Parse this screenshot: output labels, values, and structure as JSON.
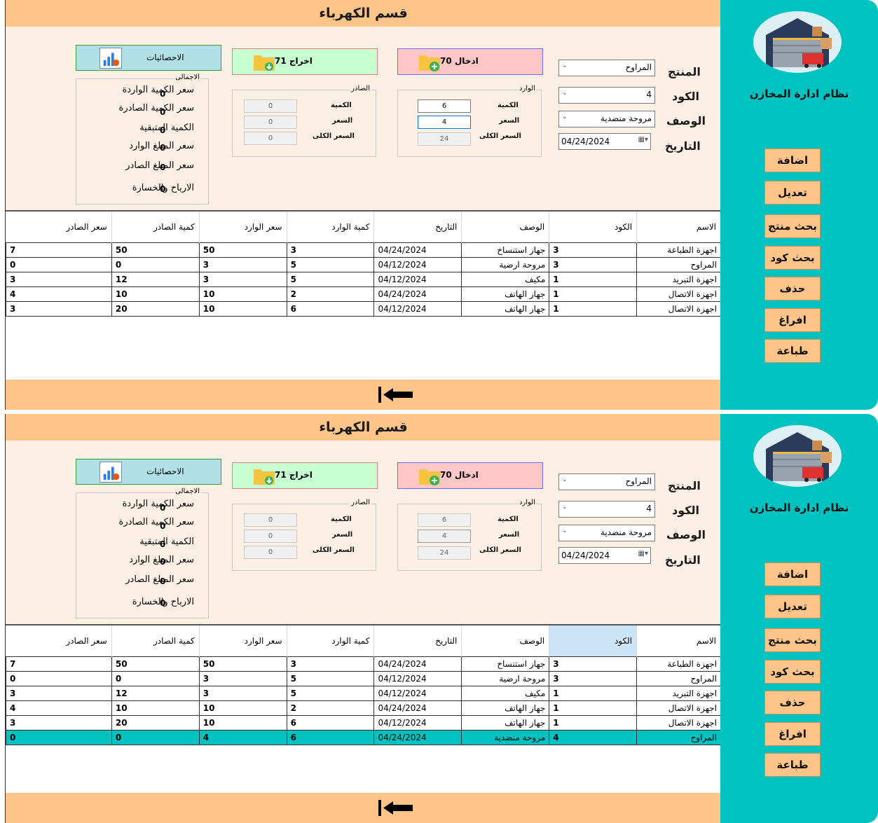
{
  "panels": [
    {
      "title": "قسم الكهرباء",
      "sidebar": {
        "app_name": "نظام ادارة المخازن",
        "buttons": [
          "اضافة",
          "تعديل",
          "بحث منتج",
          "بحث كود",
          "حذف",
          "افراغ",
          "طباعة"
        ]
      },
      "form": {
        "product_label": "المنتج",
        "product_value": "المراوح",
        "code_label": "الكود",
        "code_value": "4",
        "desc_label": "الوصف",
        "desc_value": "مروحة منضدية",
        "date_label": "التاريخ",
        "date_value": "04/24/2024"
      },
      "actions": {
        "in_label": "ادخال 70",
        "out_label": "اخراج 71",
        "stats_label": "الاحصائيات"
      },
      "incoming": {
        "title": "الوارد",
        "qty_label": "الكمية",
        "qty": "6",
        "price_label": "السعر",
        "price": "4",
        "total_label": "السعر الكلى",
        "total": "24"
      },
      "outgoing": {
        "title": "الصادر",
        "qty_label": "الكمية",
        "qty": "0",
        "price_label": "السعر",
        "price": "0",
        "total_label": "السعر الكلى",
        "total": "0"
      },
      "totals": {
        "title": "الاجمالى",
        "rows": [
          {
            "label": "سعر الكمية الواردة",
            "value": "0"
          },
          {
            "label": "سعر الكمية الصادرة",
            "value": "0"
          },
          {
            "label": "الكمية المتبقية",
            "value": "0"
          },
          {
            "label": "سعر المبلغ الوارد",
            "value": "0"
          },
          {
            "label": "سعر المبلغ الصادر",
            "value": "0"
          },
          {
            "label": "الارباح والخسارة",
            "value": "0"
          }
        ]
      },
      "table": {
        "headers": [
          "الاسم",
          "الكود",
          "الوصف",
          "التاريخ",
          "كمية الوارد",
          "سعر الوارد",
          "كمية الصادر",
          "سعر الصادر"
        ],
        "rows": [
          [
            "اجهزة الطباعة",
            "3",
            "جهاز استنساخ",
            "04/24/2024",
            "3",
            "50",
            "50",
            "7"
          ],
          [
            "المراوح",
            "3",
            "مروحة ارضية",
            "04/12/2024",
            "5",
            "3",
            "0",
            "0"
          ],
          [
            "اجهزة التبريد",
            "1",
            "مكيف",
            "04/12/2024",
            "5",
            "3",
            "12",
            "3"
          ],
          [
            "اجهزة الاتصال",
            "1",
            "جهاز الهاتف",
            "04/24/2024",
            "2",
            "10",
            "10",
            "4"
          ],
          [
            "اجهزة الاتصال",
            "1",
            "جهاز الهاتف",
            "04/12/2024",
            "6",
            "10",
            "20",
            "3"
          ]
        ]
      }
    },
    {
      "title": "قسم الكهرباء",
      "sidebar": {
        "app_name": "نظام ادارة المخازن",
        "buttons": [
          "اضافة",
          "تعديل",
          "بحث منتج",
          "بحث كود",
          "حذف",
          "افراغ",
          "طباعة"
        ]
      },
      "form": {
        "product_label": "المنتج",
        "product_value": "المراوح",
        "code_label": "الكود",
        "code_value": "4",
        "desc_label": "الوصف",
        "desc_value": "مروحة منضدية",
        "date_label": "التاريخ",
        "date_value": "04/24/2024"
      },
      "actions": {
        "in_label": "ادخال 70",
        "out_label": "اخراج 71",
        "stats_label": "الاحصائيات"
      },
      "incoming": {
        "title": "الوارد",
        "qty_label": "الكمية",
        "qty": "6",
        "price_label": "السعر",
        "price": "4",
        "total_label": "السعر الكلى",
        "total": "24"
      },
      "outgoing": {
        "title": "الصادر",
        "qty_label": "الكمية",
        "qty": "0",
        "price_label": "السعر",
        "price": "0",
        "total_label": "السعر الكلى",
        "total": "0"
      },
      "totals": {
        "title": "الاجمالى",
        "rows": [
          {
            "label": "سعر الكمية الواردة",
            "value": "0"
          },
          {
            "label": "سعر الكمية الصادرة",
            "value": "0"
          },
          {
            "label": "الكمية المتبقية",
            "value": "0"
          },
          {
            "label": "سعر المبلغ الوارد",
            "value": "0"
          },
          {
            "label": "سعر المبلغ الصادر",
            "value": "0"
          },
          {
            "label": "الارباح والخسارة",
            "value": "0"
          }
        ]
      },
      "table": {
        "headers": [
          "الاسم",
          "الكود",
          "الوصف",
          "التاريخ",
          "كمية الوارد",
          "سعر الوارد",
          "كمية الصادر",
          "سعر الصادر"
        ],
        "rows": [
          [
            "اجهزة الطباعة",
            "3",
            "جهاز استنساخ",
            "04/24/2024",
            "3",
            "50",
            "50",
            "7"
          ],
          [
            "المراوح",
            "3",
            "مروحة ارضية",
            "04/12/2024",
            "5",
            "3",
            "0",
            "0"
          ],
          [
            "اجهزة التبريد",
            "1",
            "مكيف",
            "04/12/2024",
            "5",
            "3",
            "12",
            "3"
          ],
          [
            "اجهزة الاتصال",
            "1",
            "جهاز الهاتف",
            "04/24/2024",
            "2",
            "10",
            "10",
            "4"
          ],
          [
            "اجهزة الاتصال",
            "1",
            "جهاز الهاتف",
            "04/12/2024",
            "6",
            "10",
            "20",
            "3"
          ],
          [
            "المراوح",
            "4",
            "مروحة منضدية",
            "04/24/2024",
            "6",
            "4",
            "0",
            "0"
          ]
        ]
      }
    }
  ],
  "colors": {
    "header": "#ffc487",
    "sidebar": "#00c2c0",
    "background": "#fcefe4",
    "selected_row": "#00c2c0"
  },
  "icons": {
    "logo": "warehouse-icon",
    "in": "folder-add-icon",
    "out": "folder-download-icon",
    "stats": "chart-icon",
    "back": "arrow-left-icon"
  }
}
